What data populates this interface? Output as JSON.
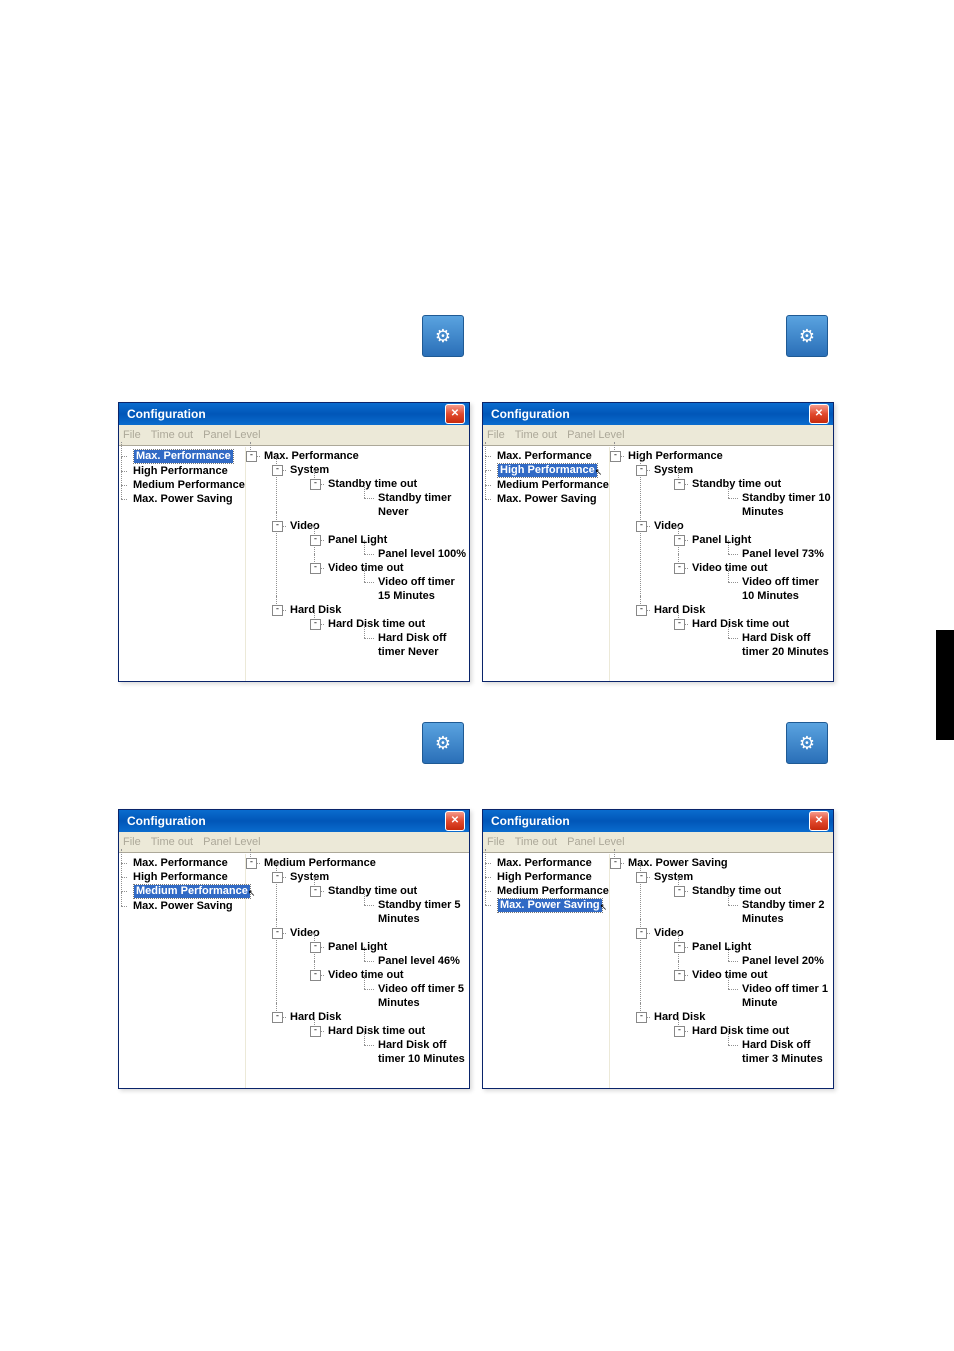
{
  "window_title": "Configuration",
  "menus": [
    "File",
    "Time out",
    "Panel Level"
  ],
  "left_items": [
    "Max. Performance",
    "High Performance",
    "Medium Performance",
    "Max. Power Saving"
  ],
  "panels": [
    {
      "selected_index": 0,
      "root": "Max. Performance",
      "standby": "Standby timer Never",
      "panel_level": "Panel level 100%",
      "video_off": "Video off timer 15 Minutes",
      "hdd_off": "Hard Disk off timer Never"
    },
    {
      "selected_index": 1,
      "root": "High Performance",
      "standby": "Standby timer 10 Minutes",
      "panel_level": "Panel level 73%",
      "video_off": "Video off timer 10 Minutes",
      "hdd_off": "Hard Disk off timer 20 Minutes"
    },
    {
      "selected_index": 2,
      "root": "Medium Performance",
      "standby": "Standby timer 5 Minutes",
      "panel_level": "Panel level 46%",
      "video_off": "Video off timer 5 Minutes",
      "hdd_off": "Hard Disk off timer 10 Minutes"
    },
    {
      "selected_index": 3,
      "root": "Max. Power Saving",
      "standby": "Standby timer 2 Minutes",
      "panel_level": "Panel level 20%",
      "video_off": "Video off timer 1 Minute",
      "hdd_off": "Hard Disk off timer 3 Minutes"
    }
  ],
  "labels": {
    "system": "System",
    "standby_timeout": "Standby time out",
    "video": "Video",
    "panel_light": "Panel Light",
    "video_timeout": "Video time out",
    "hard_disk": "Hard Disk",
    "hdd_timeout": "Hard Disk time out"
  }
}
